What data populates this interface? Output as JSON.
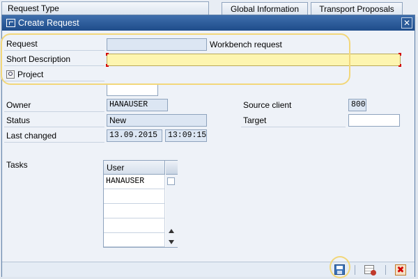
{
  "background_tabs": {
    "request_type": "Request Type",
    "global_information": "Global Information",
    "transport_proposals": "Transport Proposals"
  },
  "dialog": {
    "title": "Create Request",
    "close_glyph": "✕"
  },
  "form": {
    "request_label": "Request",
    "request_value": "",
    "request_type_text": "Workbench request",
    "short_description_label": "Short Description",
    "short_description_value": "",
    "project_label": "Project",
    "project_value": "",
    "owner_label": "Owner",
    "owner_value": "HANAUSER",
    "status_label": "Status",
    "status_value": "New",
    "last_changed_label": "Last changed",
    "last_changed_date": "13.09.2015",
    "last_changed_time": "13:09:15",
    "source_client_label": "Source client",
    "source_client_value": "800",
    "target_label": "Target",
    "target_value": ""
  },
  "tasks": {
    "label": "Tasks",
    "column_header": "User",
    "rows": [
      "HANAUSER",
      "",
      "",
      "",
      ""
    ]
  },
  "toolbar": {
    "cancel_glyph": "✖"
  },
  "colors": {
    "title_bar": "#2b5a98",
    "highlight": "#f2d77a",
    "required_field": "#fdf5b0"
  }
}
